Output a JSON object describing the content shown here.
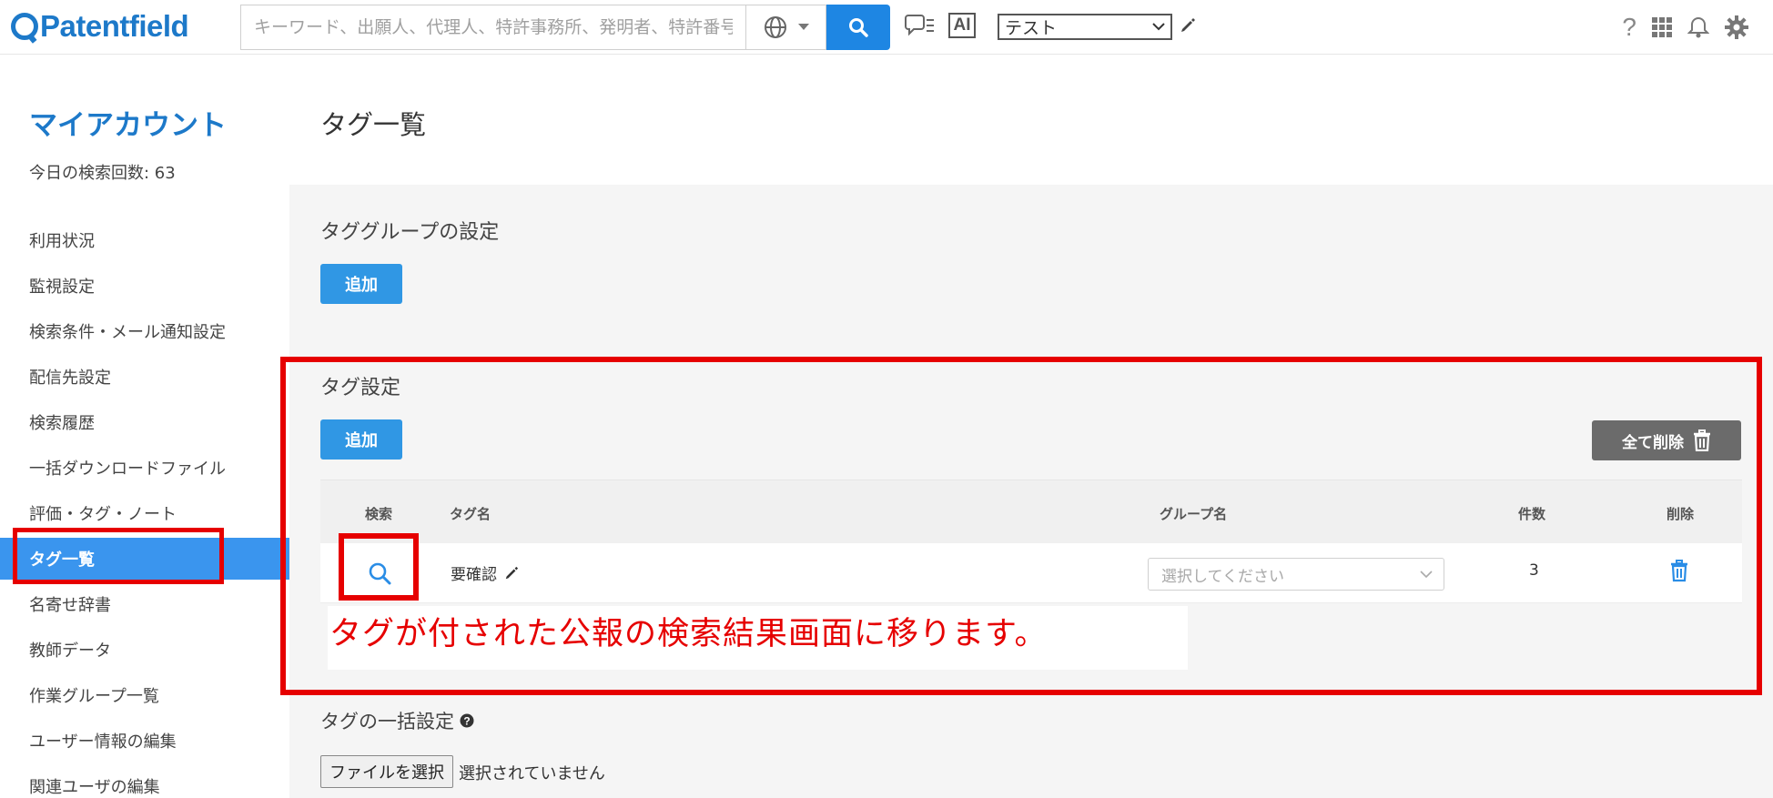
{
  "header": {
    "logo_text": "Patentfield",
    "search_placeholder": "キーワード、出願人、代理人、特許事務所、発明者、特許番号等",
    "ai_label": "AI",
    "project_select": "テスト",
    "help_symbol": "?"
  },
  "sidebar": {
    "title": "マイアカウント",
    "search_count": "今日の検索回数: 63",
    "items": [
      {
        "label": "利用状況"
      },
      {
        "label": "監視設定"
      },
      {
        "label": "検索条件・メール通知設定"
      },
      {
        "label": "配信先設定"
      },
      {
        "label": "検索履歴"
      },
      {
        "label": "一括ダウンロードファイル"
      },
      {
        "label": "評価・タグ・ノート"
      },
      {
        "label": "タグ一覧"
      },
      {
        "label": "名寄せ辞書"
      },
      {
        "label": "教師データ"
      },
      {
        "label": "作業グループ一覧"
      },
      {
        "label": "ユーザー情報の編集"
      },
      {
        "label": "関連ユーザの編集"
      }
    ],
    "active_index": 7
  },
  "main": {
    "page_title": "タグ一覧",
    "tag_group_section": {
      "title": "タググループの設定",
      "add_label": "追加"
    },
    "tag_section": {
      "title": "タグ設定",
      "add_label": "追加",
      "delete_all_label": "全て削除",
      "columns": [
        "検索",
        "タグ名",
        "グループ名",
        "件数",
        "削除"
      ],
      "rows": [
        {
          "tag_name": "要確認",
          "group_placeholder": "選択してください",
          "count": "3"
        }
      ]
    },
    "annotation": "タグが付された公報の検索結果画面に移ります。",
    "bulk_section": {
      "title": "タグの一括設定",
      "file_button": "ファイルを選択",
      "file_status": "選択されていません"
    }
  },
  "colors": {
    "brand": "#1d79c9",
    "primary_button": "#3097e4",
    "active_nav": "#3a95ee",
    "highlight_red": "#e60000",
    "delete_all_button": "#6b6b6b"
  }
}
